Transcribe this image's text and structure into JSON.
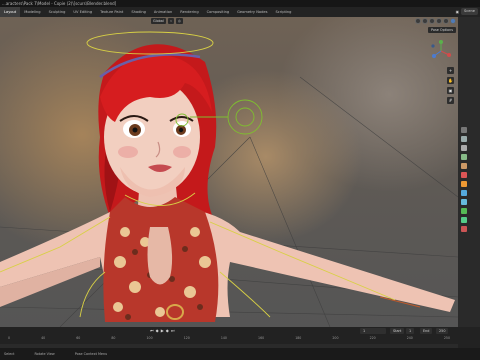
{
  "title_bar": {
    "text": "...aracters\\Pack 7\\Model - Copie (2)\\[scurs\\Blender.blend]"
  },
  "workspace_tabs": [
    {
      "label": "Layout",
      "active": true
    },
    {
      "label": "Modeling",
      "active": false
    },
    {
      "label": "Sculpting",
      "active": false
    },
    {
      "label": "UV Editing",
      "active": false
    },
    {
      "label": "Texture Paint",
      "active": false
    },
    {
      "label": "Shading",
      "active": false
    },
    {
      "label": "Animation",
      "active": false
    },
    {
      "label": "Rendering",
      "active": false
    },
    {
      "label": "Compositing",
      "active": false
    },
    {
      "label": "Geometry Nodes",
      "active": false
    },
    {
      "label": "Scripting",
      "active": false
    }
  ],
  "scene": {
    "label": "Scene"
  },
  "viewport": {
    "orientation": "Global",
    "pose_options": "Pose Options"
  },
  "timeline": {
    "current_frame": "1",
    "start_label": "Start",
    "start": "1",
    "end_label": "End",
    "end": "250",
    "ticks": [
      "0",
      "40",
      "60",
      "80",
      "100",
      "120",
      "140",
      "160",
      "180",
      "200",
      "220",
      "240",
      "250"
    ]
  },
  "status_bar": {
    "left": "Select",
    "middle": "Rotate View",
    "right": "Pose Context Menu"
  },
  "colors": {
    "hair": "#d61d1f",
    "skin": "#f2cfc0",
    "bone_yellow": "#d8d045",
    "bone_green": "#7fbf2f",
    "accent": "#4f7bb8"
  }
}
